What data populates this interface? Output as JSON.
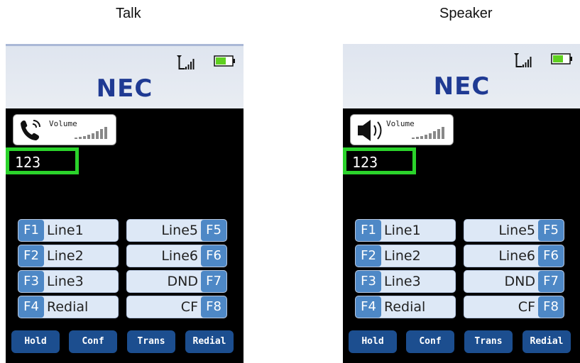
{
  "captions": {
    "talk": "Talk",
    "speaker": "Speaker"
  },
  "colors": {
    "highlight": "#2bd32b",
    "fkey_tag": "#4e88c6",
    "softkey": "#1c4e8f",
    "battery": "#5fd020"
  },
  "phones": [
    {
      "mode": "talk",
      "brand": "NEC",
      "volume_label": "Volume",
      "volume_icon": "handset-icon",
      "number": "123",
      "fkeys_left": [
        {
          "tag": "F1",
          "label": "Line1"
        },
        {
          "tag": "F2",
          "label": "Line2"
        },
        {
          "tag": "F3",
          "label": "Line3"
        },
        {
          "tag": "F4",
          "label": "Redial"
        }
      ],
      "fkeys_right": [
        {
          "tag": "F5",
          "label": "Line5"
        },
        {
          "tag": "F6",
          "label": "Line6"
        },
        {
          "tag": "F7",
          "label": "DND"
        },
        {
          "tag": "F8",
          "label": "CF"
        }
      ],
      "softkeys": [
        "Hold",
        "Conf",
        "Trans",
        "Redial"
      ]
    },
    {
      "mode": "speaker",
      "brand": "NEC",
      "volume_label": "Volume",
      "volume_icon": "speaker-icon",
      "number": "123",
      "fkeys_left": [
        {
          "tag": "F1",
          "label": "Line1"
        },
        {
          "tag": "F2",
          "label": "Line2"
        },
        {
          "tag": "F3",
          "label": "Line3"
        },
        {
          "tag": "F4",
          "label": "Redial"
        }
      ],
      "fkeys_right": [
        {
          "tag": "F5",
          "label": "Line5"
        },
        {
          "tag": "F6",
          "label": "Line6"
        },
        {
          "tag": "F7",
          "label": "DND"
        },
        {
          "tag": "F8",
          "label": "CF"
        }
      ],
      "softkeys": [
        "Hold",
        "Conf",
        "Trans",
        "Redial"
      ]
    }
  ]
}
